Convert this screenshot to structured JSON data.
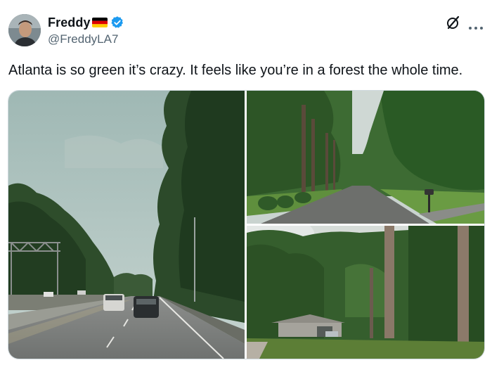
{
  "author": {
    "display_name": "Freddy",
    "flag_icon": "germany-flag-icon",
    "handle": "@FreddyLA7",
    "verified": true,
    "verified_color": "#1d9bf0"
  },
  "tweet": {
    "text": "Atlanta is so green it’s crazy. It feels like you’re in a forest the whole time."
  },
  "media": {
    "photos": [
      {
        "name": "photo-highway",
        "icon": "photo"
      },
      {
        "name": "photo-residential-road",
        "icon": "photo"
      },
      {
        "name": "photo-house-in-trees",
        "icon": "photo"
      }
    ]
  },
  "icons": {
    "grok": "grok-icon",
    "more": "more-options-icon"
  },
  "colors": {
    "text": "#0f1419",
    "secondary_text": "#536471",
    "border": "#cfd9de"
  }
}
